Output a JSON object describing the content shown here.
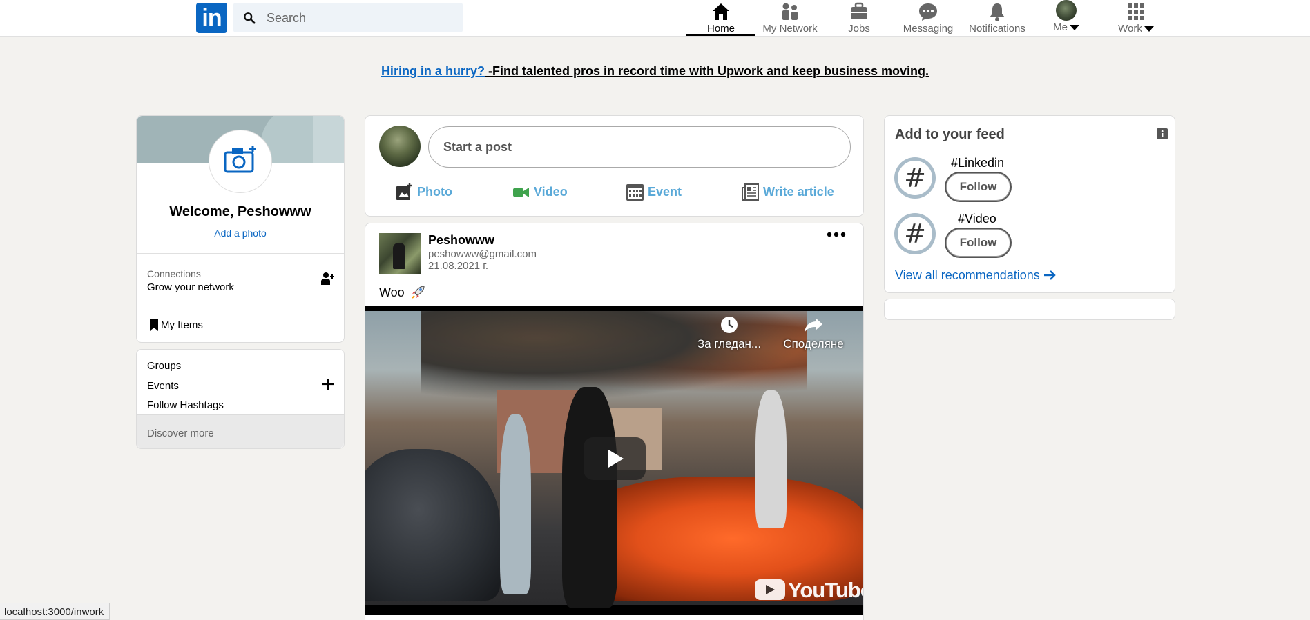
{
  "nav": {
    "logo_text": "in",
    "search_placeholder": "Search",
    "items": [
      {
        "label": "Home",
        "icon": "home-icon"
      },
      {
        "label": "My Network",
        "icon": "network-icon"
      },
      {
        "label": "Jobs",
        "icon": "briefcase-icon"
      },
      {
        "label": "Messaging",
        "icon": "chat-icon"
      },
      {
        "label": "Notifications",
        "icon": "bell-icon"
      },
      {
        "label": "Me",
        "icon": "avatar"
      },
      {
        "label": "Work",
        "icon": "grid-icon"
      }
    ]
  },
  "promo": {
    "link_text": "Hiring in a hurry?",
    "rest_text": " -Find talented pros in record time with Upwork and keep business moving."
  },
  "profile": {
    "welcome": "Welcome, Peshowww",
    "add_photo": "Add a photo",
    "connections_label": "Connections",
    "connections_sub": "Grow your network",
    "my_items": "My Items"
  },
  "groups_card": {
    "groups": "Groups",
    "events": "Events",
    "follow_hashtags": "Follow Hashtags",
    "discover_more": "Discover more"
  },
  "composer": {
    "start_post": "Start a post",
    "actions": [
      {
        "label": "Photo",
        "icon": "photo-icon"
      },
      {
        "label": "Video",
        "icon": "video-icon"
      },
      {
        "label": "Event",
        "icon": "calendar-icon"
      },
      {
        "label": "Write article",
        "icon": "article-icon"
      }
    ]
  },
  "post": {
    "author": "Peshowww",
    "email": "peshowww@gmail.com",
    "date": "21.08.2021 г.",
    "text": "Woo",
    "video": {
      "watch_later": "За гледан...",
      "share": "Споделяне",
      "brand": "YouTube"
    }
  },
  "feed": {
    "title": "Add to your feed",
    "hashtags": [
      {
        "name": "#Linkedin",
        "button": "Follow"
      },
      {
        "name": "#Video",
        "button": "Follow"
      }
    ],
    "view_all": "View all recommendations"
  },
  "status_url": "localhost:3000/inwork",
  "colors": {
    "brand": "#0a66c2",
    "background": "#f3f2ef",
    "action_blue": "#5aa9d8",
    "video_green": "#3fa34d"
  }
}
